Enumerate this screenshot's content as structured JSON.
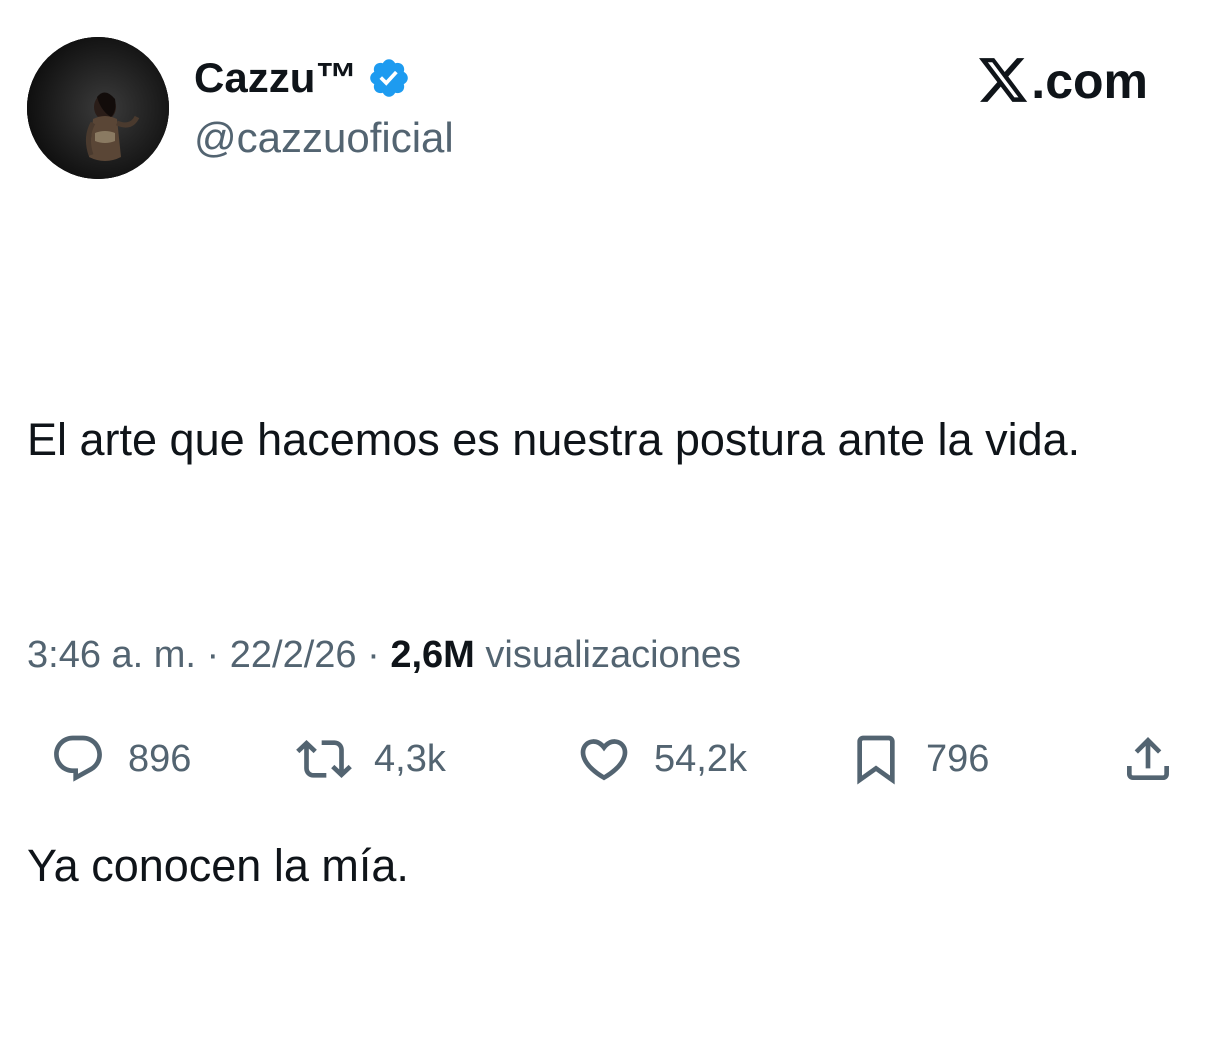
{
  "author": {
    "display_name": "Cazzu™",
    "handle": "@cazzuoficial",
    "verified": true,
    "verified_color": "#1d9bf0"
  },
  "brand": {
    "label": ".com"
  },
  "tweet": {
    "paragraphs": [
      "El arte que hacemos es nuestra postura ante la vida.",
      "Ya conocen la mía."
    ]
  },
  "meta": {
    "time": "3:46 a. m.",
    "separator": "·",
    "date": "22/2/26",
    "views_count": "2,6M",
    "views_label": "visualizaciones"
  },
  "actions": {
    "replies": {
      "icon": "reply-icon",
      "count": "896"
    },
    "reposts": {
      "icon": "repost-icon",
      "count": "4,3k"
    },
    "likes": {
      "icon": "heart-icon",
      "count": "54,2k"
    },
    "bookmarks": {
      "icon": "bookmark-icon",
      "count": "796"
    },
    "share": {
      "icon": "share-icon"
    }
  },
  "colors": {
    "text": "#0f1419",
    "secondary": "#536471",
    "accent": "#1d9bf0"
  }
}
